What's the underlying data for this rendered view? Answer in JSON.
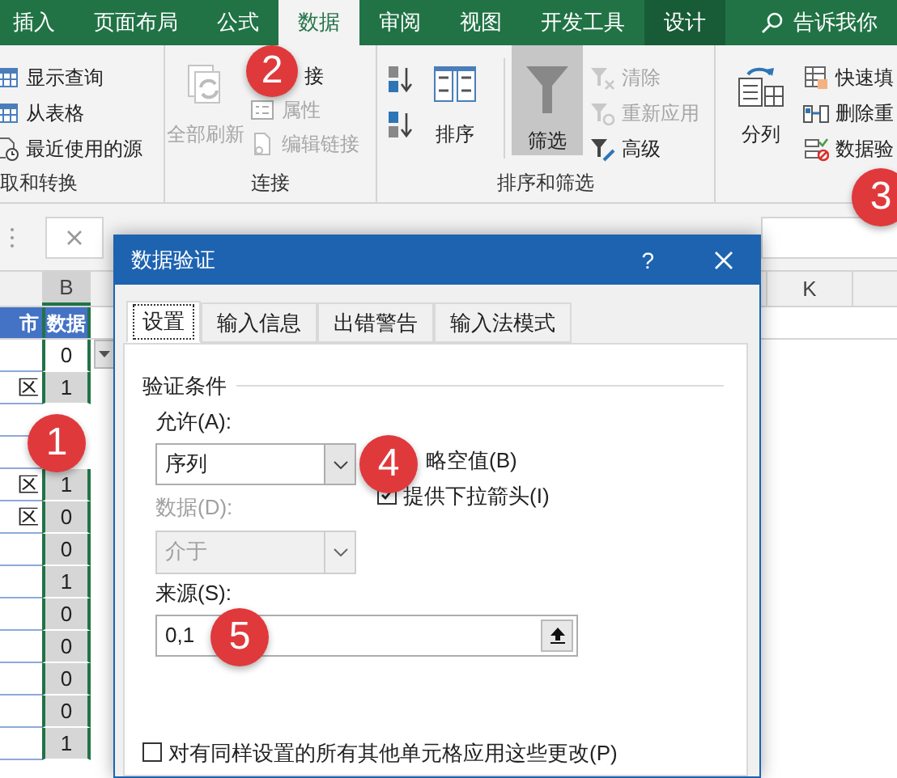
{
  "ribbon_tabs": [
    {
      "label": "插入",
      "selected": false,
      "kind": "tab"
    },
    {
      "label": "页面布局",
      "selected": false,
      "kind": "tab"
    },
    {
      "label": "公式",
      "selected": false,
      "kind": "tab"
    },
    {
      "label": "数据",
      "selected": true,
      "kind": "tab"
    },
    {
      "label": "审阅",
      "selected": false,
      "kind": "tab"
    },
    {
      "label": "视图",
      "selected": false,
      "kind": "tab"
    },
    {
      "label": "开发工具",
      "selected": false,
      "kind": "tab"
    },
    {
      "label": "设计",
      "selected": false,
      "kind": "contextual"
    }
  ],
  "tell_me": {
    "placeholder": "告诉我你"
  },
  "ribbon_groups": [
    {
      "label": "取和转换",
      "items": [
        {
          "label": "显示查询",
          "kind": "small",
          "disabled": false,
          "pressed": false
        },
        {
          "label": "从表格",
          "kind": "small",
          "disabled": false,
          "pressed": false
        },
        {
          "label": "最近使用的源",
          "kind": "small",
          "disabled": false,
          "pressed": false
        }
      ]
    },
    {
      "label": "连接",
      "items": [
        {
          "label": "全部刷新",
          "kind": "large",
          "disabled": true,
          "pressed": false
        },
        {
          "label": "接",
          "kind": "small",
          "disabled": false,
          "pressed": false
        },
        {
          "label": "属性",
          "kind": "small",
          "disabled": true,
          "pressed": false
        },
        {
          "label": "编辑链接",
          "kind": "small",
          "disabled": true,
          "pressed": false
        }
      ]
    },
    {
      "label": "排序和筛选",
      "items": [
        {
          "label": "排序",
          "kind": "large",
          "disabled": false,
          "pressed": false
        },
        {
          "label": "筛选",
          "kind": "large",
          "disabled": false,
          "pressed": true
        },
        {
          "label": "清除",
          "kind": "small",
          "disabled": true,
          "pressed": false
        },
        {
          "label": "重新应用",
          "kind": "small",
          "disabled": true,
          "pressed": false
        },
        {
          "label": "高级",
          "kind": "small",
          "disabled": false,
          "pressed": false
        }
      ]
    },
    {
      "items": [
        {
          "label": "分列",
          "kind": "large",
          "disabled": false,
          "pressed": false
        },
        {
          "label": "快速填",
          "kind": "small",
          "disabled": false,
          "pressed": false
        },
        {
          "label": "删除重",
          "kind": "small",
          "disabled": false,
          "pressed": false
        },
        {
          "label": "数据验",
          "kind": "small",
          "disabled": false,
          "pressed": false
        }
      ]
    }
  ],
  "sheet": {
    "column_headers": [
      {
        "label": "B",
        "selected": true
      },
      {
        "label": "K",
        "selected": false
      }
    ],
    "header_row": [
      "市",
      "数据"
    ],
    "rows": [
      {
        "value": "0",
        "active": true
      },
      {
        "column_a": "区",
        "value": "1",
        "active": false
      },
      {},
      {},
      {
        "column_a": "区",
        "value": "1",
        "active": false
      },
      {
        "column_a": "区",
        "value": "0",
        "active": false
      },
      {
        "value": "0",
        "active": false
      },
      {
        "value": "1",
        "active": false
      },
      {
        "value": "0",
        "active": false
      },
      {
        "value": "0",
        "active": false
      },
      {
        "value": "0",
        "active": false
      },
      {
        "value": "0",
        "active": false
      },
      {
        "value": "1",
        "active": false
      }
    ]
  },
  "dialog": {
    "title": "数据验证",
    "help_button": "?",
    "tabs": [
      {
        "label": "设置",
        "selected": true
      },
      {
        "label": "输入信息",
        "selected": false
      },
      {
        "label": "出错警告",
        "selected": false
      },
      {
        "label": "输入法模式",
        "selected": false
      }
    ],
    "group_label": "验证条件",
    "allow": {
      "label": "允许(A):",
      "value": "序列"
    },
    "ignore_blank": {
      "label": "略空值(B)"
    },
    "in_cell_dropdown": {
      "label": "提供下拉箭头(I)",
      "checked": true
    },
    "data": {
      "label": "数据(D):",
      "value": "介于",
      "disabled": true
    },
    "source": {
      "label": "来源(S):",
      "value": "0,1"
    },
    "apply_all": {
      "label": "对有同样设置的所有其他单元格应用这些更改(P)",
      "checked": false
    }
  },
  "callouts": [
    "1",
    "2",
    "3",
    "4",
    "5"
  ]
}
